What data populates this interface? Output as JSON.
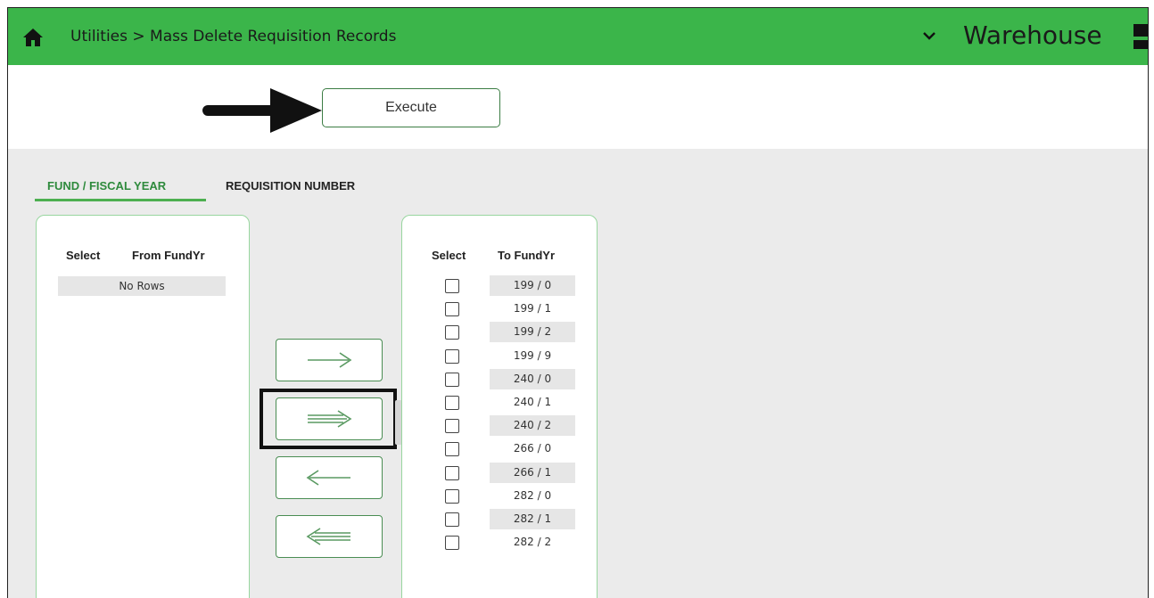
{
  "header": {
    "breadcrumb": "Utilities > Mass Delete Requisition Records",
    "app_name": "Warehouse",
    "background": "#3bb54a",
    "home_icon": "home-icon",
    "dropdown_icon": "chevron-down-icon"
  },
  "toolbar": {
    "execute_label": "Execute"
  },
  "tabs": [
    {
      "label": "FUND / FISCAL YEAR",
      "active": true
    },
    {
      "label": "REQUISITION NUMBER",
      "active": false
    }
  ],
  "from_panel": {
    "select_header": "Select",
    "fund_header": "From FundYr",
    "empty_text": "No Rows"
  },
  "to_panel": {
    "select_header": "Select",
    "fund_header": "To FundYr",
    "rows": [
      "199 / 0",
      "199 / 1",
      "199 / 2",
      "199 / 9",
      "240 / 0",
      "240 / 1",
      "240 / 2",
      "266 / 0",
      "266 / 1",
      "282 / 0",
      "282 / 1",
      "282 / 2"
    ]
  },
  "move_buttons": [
    {
      "name": "move-selected-right-button",
      "icon": "arrow-right-icon"
    },
    {
      "name": "move-all-right-button",
      "icon": "double-arrow-right-icon"
    },
    {
      "name": "move-selected-left-button",
      "icon": "arrow-left-icon"
    },
    {
      "name": "move-all-left-button",
      "icon": "double-arrow-left-icon"
    }
  ],
  "accent_color": "#3bb54a"
}
